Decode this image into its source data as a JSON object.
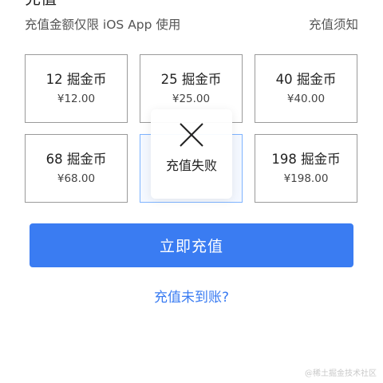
{
  "header": {
    "title": "充值",
    "notice": "充值金额仅限 iOS App 使用",
    "rules_link": "充值须知"
  },
  "packages": [
    {
      "coins": "12 掘金币",
      "price": "¥12.00"
    },
    {
      "coins": "25 掘金币",
      "price": "¥25.00"
    },
    {
      "coins": "40 掘金币",
      "price": "¥40.00"
    },
    {
      "coins": "68 掘金币",
      "price": "¥68.00"
    },
    {
      "coins": "",
      "price": ""
    },
    {
      "coins": "198 掘金币",
      "price": "¥198.00"
    }
  ],
  "toast": {
    "icon": "close-icon",
    "message": "充值失败"
  },
  "actions": {
    "recharge_button": "立即充值",
    "help_link": "充值未到账?"
  },
  "watermark": "@稀土掘金技术社区",
  "colors": {
    "accent": "#3a7cf2",
    "selected_border": "#7fb4ff",
    "card_border": "#9a9a9a"
  }
}
